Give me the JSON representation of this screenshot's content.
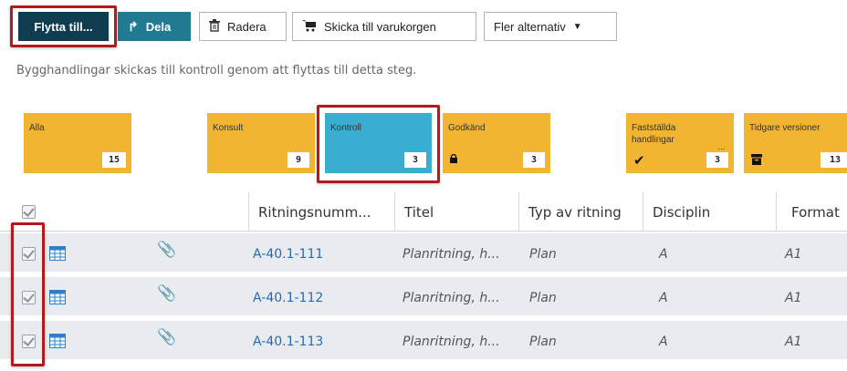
{
  "toolbar": {
    "move_label": "Flytta till...",
    "share_label": "Dela",
    "delete_label": "Radera",
    "cart_label": "Skicka till varukorgen",
    "more_label": "Fler alternativ"
  },
  "hint_text": "Bygghandlingar skickas till kontroll genom att flyttas till detta steg.",
  "tiles": [
    {
      "label": "Alla",
      "count": "15"
    },
    {
      "label": "Konsult",
      "count": "9"
    },
    {
      "label": "Kontroll",
      "count": "3",
      "active": true
    },
    {
      "label": "Godkänd",
      "count": "3",
      "icon": "lock-icon"
    },
    {
      "label": "Fastställda handlingar",
      "extra": "...",
      "count": "3",
      "icon": "checkmark-icon"
    },
    {
      "label": "Tidgare versioner",
      "count": "13",
      "icon": "archive-icon"
    }
  ],
  "table": {
    "columns": [
      "Ritningsnumm...",
      "Titel",
      "Typ av ritning",
      "Disciplin",
      "Format"
    ],
    "rows": [
      {
        "number": "A-40.1-111",
        "title": "Planritning, h...",
        "type": "Plan",
        "discipline": "A",
        "format": "A1"
      },
      {
        "number": "A-40.1-112",
        "title": "Planritning, h...",
        "type": "Plan",
        "discipline": "A",
        "format": "A1"
      },
      {
        "number": "A-40.1-113",
        "title": "Planritning, h...",
        "type": "Plan",
        "discipline": "A",
        "format": "A1"
      }
    ]
  },
  "colors": {
    "tile": "#f2b531",
    "tile_active": "#3aaed0",
    "highlight": "#b11b1e",
    "link": "#2c6aa8"
  }
}
